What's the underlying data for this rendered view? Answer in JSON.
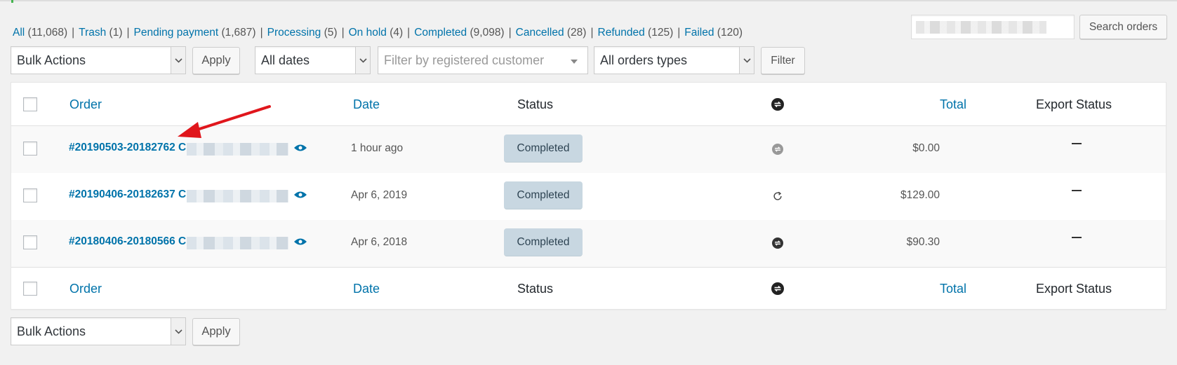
{
  "status_filters": [
    {
      "label": "All",
      "count": "(11,068)"
    },
    {
      "label": "Trash",
      "count": "(1)"
    },
    {
      "label": "Pending payment",
      "count": "(1,687)"
    },
    {
      "label": "Processing",
      "count": "(5)"
    },
    {
      "label": "On hold",
      "count": "(4)"
    },
    {
      "label": "Completed",
      "count": "(9,098)"
    },
    {
      "label": "Cancelled",
      "count": "(28)"
    },
    {
      "label": "Refunded",
      "count": "(125)"
    },
    {
      "label": "Failed",
      "count": "(120)"
    }
  ],
  "search": {
    "value": "",
    "button_label": "Search orders"
  },
  "toolbar_top": {
    "bulk_actions": "Bulk Actions",
    "apply_label": "Apply",
    "dates": "All dates",
    "customer_placeholder": "Filter by registered customer",
    "order_types": "All orders types",
    "filter_label": "Filter"
  },
  "table": {
    "columns": {
      "order": "Order",
      "date": "Date",
      "status": "Status",
      "subscription_icon": "subscription-icon",
      "total": "Total",
      "export_status": "Export Status"
    },
    "rows": [
      {
        "order": "#20190503-20182762 C",
        "date": "1 hour ago",
        "status": "Completed",
        "sub_icon": "subscription-grey-icon",
        "total": "$0.00",
        "export": "—"
      },
      {
        "order": "#20190406-20182637 C",
        "date": "Apr 6, 2019",
        "status": "Completed",
        "sub_icon": "renewal-icon",
        "total": "$129.00",
        "export": "—"
      },
      {
        "order": "#20180406-20180566 C",
        "date": "Apr 6, 2018",
        "status": "Completed",
        "sub_icon": "subscription-icon",
        "total": "$90.30",
        "export": "—"
      }
    ]
  },
  "toolbar_bottom": {
    "bulk_actions": "Bulk Actions",
    "apply_label": "Apply"
  },
  "colors": {
    "link": "#0073aa",
    "badge_bg": "#c8d7e1",
    "arrow": "#e0161c"
  }
}
